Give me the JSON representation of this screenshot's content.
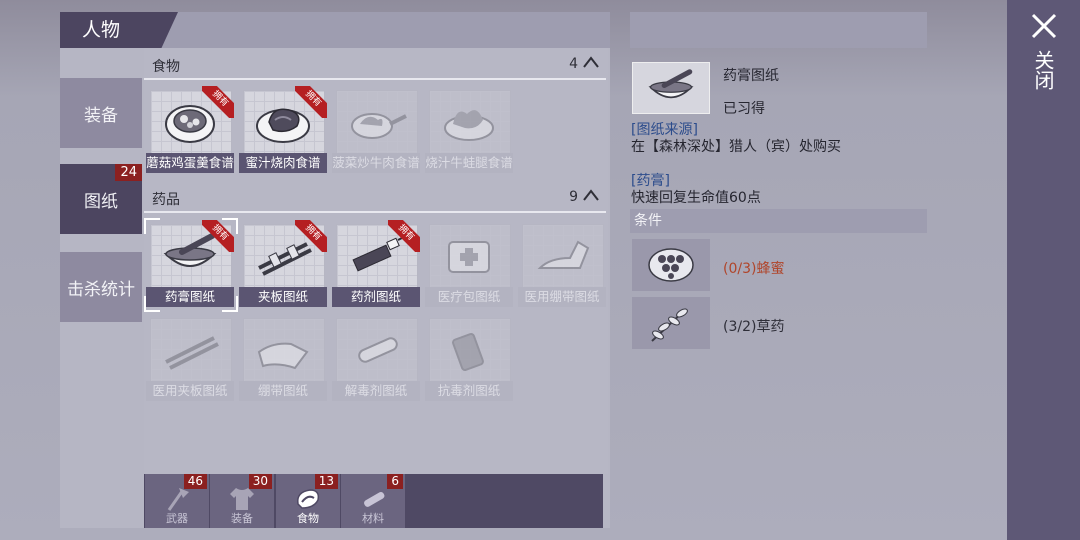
{
  "title_tab": "人物",
  "side_nav": [
    {
      "label": "装备",
      "badge": ""
    },
    {
      "label": "图纸",
      "badge": "24"
    },
    {
      "label": "击杀统计",
      "badge": ""
    }
  ],
  "sections": [
    {
      "title": "食物",
      "count": "4",
      "items": [
        {
          "label": "蘑菇鸡蛋羹食谱",
          "owned": true,
          "icon": "mushroom-egg-bowl-icon"
        },
        {
          "label": "蜜汁烧肉食谱",
          "owned": true,
          "icon": "honey-meat-plate-icon"
        },
        {
          "label": "菠菜炒牛肉食谱",
          "owned": false,
          "icon": "spinach-beef-pan-icon"
        },
        {
          "label": "烧汁牛蛙腿食谱",
          "owned": false,
          "icon": "frog-legs-plate-icon"
        }
      ]
    },
    {
      "title": "药品",
      "count": "9",
      "items": [
        {
          "label": "药膏图纸",
          "owned": true,
          "icon": "ointment-bowl-icon"
        },
        {
          "label": "夹板图纸",
          "owned": true,
          "icon": "splint-icon"
        },
        {
          "label": "药剂图纸",
          "owned": true,
          "icon": "syringe-icon"
        },
        {
          "label": "医疗包图纸",
          "owned": false,
          "icon": "medkit-bag-icon"
        },
        {
          "label": "医用绷带图纸",
          "owned": false,
          "icon": "medical-bandage-icon"
        },
        {
          "label": "医用夹板图纸",
          "owned": false,
          "icon": "medical-splint-icon"
        },
        {
          "label": "绷带图纸",
          "owned": false,
          "icon": "bandage-roll-icon"
        },
        {
          "label": "解毒剂图纸",
          "owned": false,
          "icon": "antidote-tube-icon"
        },
        {
          "label": "抗毒剂图纸",
          "owned": false,
          "icon": "antitoxin-bottle-icon"
        }
      ]
    }
  ],
  "owned_badge": "拥有",
  "bottom_tabs": [
    {
      "label": "武器",
      "count": "46",
      "icon": "axe-icon"
    },
    {
      "label": "装备",
      "count": "30",
      "icon": "shirt-icon"
    },
    {
      "label": "食物",
      "count": "13",
      "icon": "meat-icon"
    },
    {
      "label": "材料",
      "count": "6",
      "icon": "material-log-icon"
    }
  ],
  "detail": {
    "name": "药膏图纸",
    "status": "已习得",
    "source_header": "[图纸来源]",
    "source_text": "在【森林深处】猎人（宾）处购买",
    "effect_header": "[药膏]",
    "effect_text": "快速回复生命值60点",
    "conditions_header": "条件",
    "conditions": [
      {
        "text": "(0/3)蜂蜜",
        "color": "#b0452a",
        "icon": "honeycomb-icon"
      },
      {
        "text": "(3/2)草药",
        "color": "#2e2e38",
        "icon": "herb-icon"
      }
    ]
  },
  "close_label": "关闭",
  "colors": {
    "accent_dark": "#4c4560",
    "badge_red": "#8b2020",
    "owned_red": "#b51f22"
  }
}
